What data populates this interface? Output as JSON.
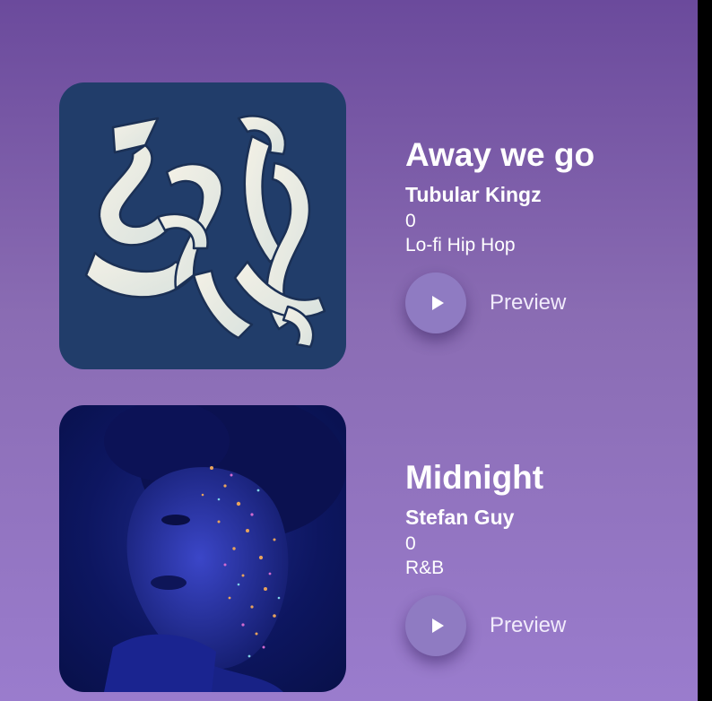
{
  "tracks": [
    {
      "title": "Away we go",
      "artist": "Tubular Kingz",
      "plays": "0",
      "genre": "Lo-fi Hip Hop",
      "preview_label": "Preview",
      "art_icon": "ribbon-lettering-artwork"
    },
    {
      "title": "Midnight",
      "artist": "Stefan Guy",
      "plays": "0",
      "genre": "R&B",
      "preview_label": "Preview",
      "art_icon": "glitter-portrait-artwork"
    }
  ],
  "colors": {
    "background_top": "#6b4a9c",
    "background_bottom": "#9a7ccd",
    "play_button": "#8f7bc2",
    "art_1_background": "#213d6a",
    "art_2_background": "#0d1660"
  }
}
